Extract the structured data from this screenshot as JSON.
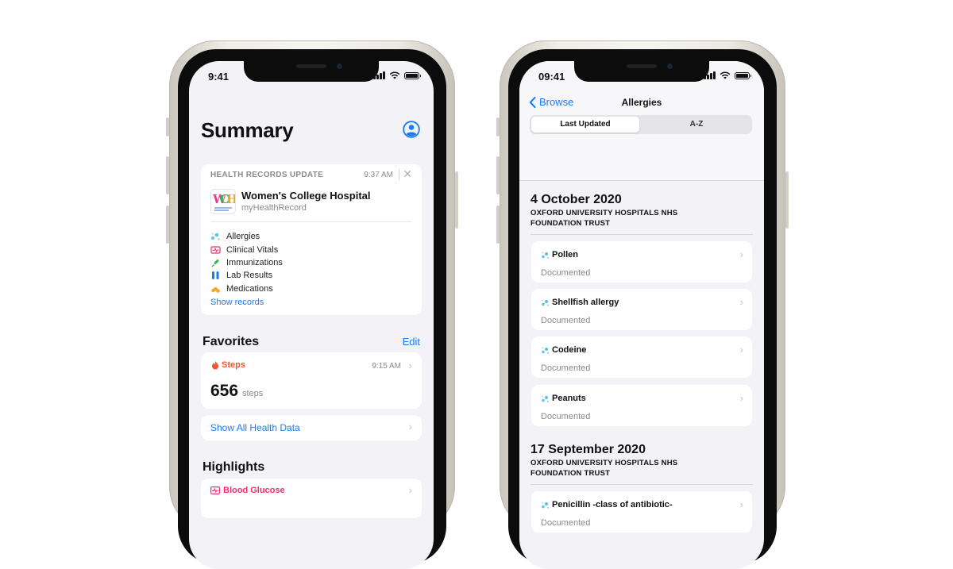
{
  "left_phone": {
    "status_time": "9:41",
    "title": "Summary",
    "health_records": {
      "header": "HEALTH RECORDS UPDATE",
      "time": "9:37 AM",
      "close_glyph": "✕",
      "hospital_name": "Women's College Hospital",
      "hospital_sub": "myHealthRecord",
      "logo_letters": [
        "W",
        "C",
        "H"
      ],
      "categories": [
        {
          "label": "Allergies",
          "icon": "allergy-icon",
          "color": "#5fc4e0"
        },
        {
          "label": "Clinical Vitals",
          "icon": "vitals-icon",
          "color": "#f0306a"
        },
        {
          "label": "Immunizations",
          "icon": "syringe-icon",
          "color": "#3cb55a"
        },
        {
          "label": "Lab Results",
          "icon": "test-tubes-icon",
          "color": "#1a7cf5"
        },
        {
          "label": "Medications",
          "icon": "pills-icon",
          "color": "#f5a623"
        }
      ],
      "show_records": "Show records"
    },
    "favorites": {
      "title": "Favorites",
      "edit": "Edit",
      "steps_label": "Steps",
      "steps_time": "9:15 AM",
      "steps_value": "656",
      "steps_unit": "steps",
      "show_all": "Show All Health Data"
    },
    "highlights": {
      "title": "Highlights",
      "item_label": "Blood Glucose"
    }
  },
  "right_phone": {
    "status_time": "09:41",
    "back_label": "Browse",
    "nav_title": "Allergies",
    "segments": [
      "Last Updated",
      "A-Z"
    ],
    "groups": [
      {
        "date": "4 October 2020",
        "org_line1": "OXFORD UNIVERSITY HOSPITALS NHS",
        "org_line2": "FOUNDATION TRUST",
        "items": [
          {
            "name": "Pollen",
            "status": "Documented"
          },
          {
            "name": "Shellfish allergy",
            "status": "Documented"
          },
          {
            "name": "Codeine",
            "status": "Documented"
          },
          {
            "name": "Peanuts",
            "status": "Documented"
          }
        ]
      },
      {
        "date": "17 September 2020",
        "org_line1": "OXFORD UNIVERSITY HOSPITALS NHS",
        "org_line2": "FOUNDATION TRUST",
        "items": [
          {
            "name": "Penicillin -class of antibiotic-",
            "status": "Documented"
          }
        ]
      }
    ]
  },
  "colors": {
    "accent_blue": "#1a7cf5",
    "steps_orange": "#f2552c",
    "glucose_pink": "#f0306a",
    "allergy_cyan": "#5fc4e0"
  }
}
